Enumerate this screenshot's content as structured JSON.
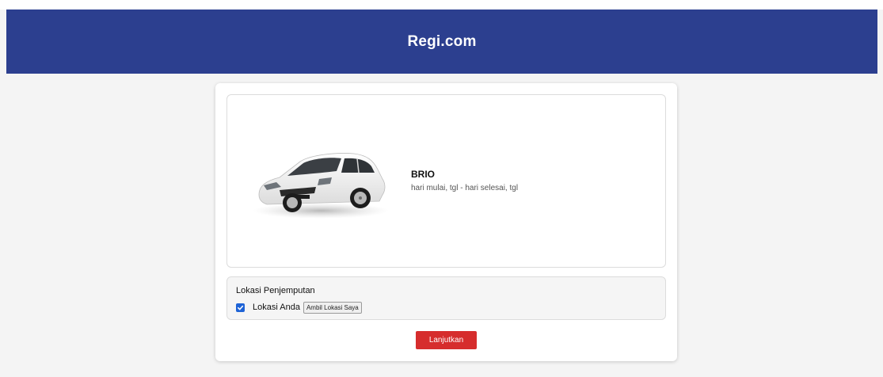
{
  "header": {
    "brand": "Regi.com"
  },
  "vehicle": {
    "name": "BRIO",
    "dates": "hari mulai, tgl - hari selesai, tgl",
    "image_icon": "car-photo"
  },
  "pickup": {
    "title": "Lokasi Penjemputan",
    "checkbox_checked": true,
    "checkbox_label": "Lokasi Anda",
    "location_button": "Ambil Lokasi Saya"
  },
  "actions": {
    "next_label": "Lanjutkan"
  },
  "colors": {
    "header_bg": "#2c3f8f",
    "primary_button": "#d62d2d",
    "checkbox": "#1e63d6"
  }
}
